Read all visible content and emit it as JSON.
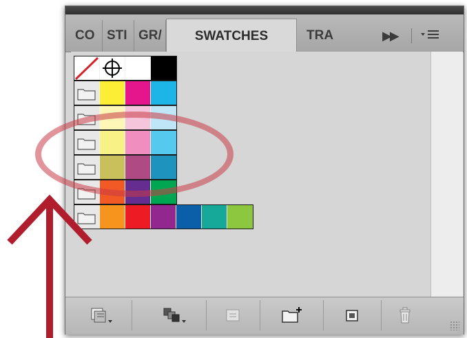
{
  "panel": {
    "tabs": [
      {
        "label": "CO",
        "active": false
      },
      {
        "label": "STI",
        "active": false
      },
      {
        "label": "GR/",
        "active": false
      },
      {
        "label": "SWATCHES",
        "active": true
      },
      {
        "label": "TRA",
        "active": false
      }
    ],
    "controls": {
      "expand_icon": "double-chevron-right",
      "menu_icon": "panel-menu"
    }
  },
  "swatches": {
    "special_row": [
      "none",
      "registration",
      "#ffffff",
      "#000000"
    ],
    "groups": [
      {
        "name": "group-1",
        "colors": [
          "#fcee35",
          "#e5158c",
          "#1db4e8"
        ]
      },
      {
        "name": "group-2",
        "colors": [
          "#fdf6b6",
          "#f5c5dc",
          "#bfe6f7"
        ]
      },
      {
        "name": "group-3",
        "colors": [
          "#f8f186",
          "#f08fbf",
          "#56c9ef"
        ]
      },
      {
        "name": "group-4",
        "colors": [
          "#c9c05c",
          "#b04a85",
          "#1e93bd"
        ]
      },
      {
        "name": "group-5",
        "colors": [
          "#f15a24",
          "#662d91",
          "#00a651"
        ]
      },
      {
        "name": "group-6",
        "colors": [
          "#f7941d",
          "#ed1c24",
          "#92278f",
          "#0b5ea8",
          "#16a99a",
          "#8dc63f"
        ]
      }
    ]
  },
  "bottom_buttons": [
    {
      "name": "swatch-libraries-menu-button",
      "icon": "libraries-icon"
    },
    {
      "name": "show-swatch-kinds-menu-button",
      "icon": "swatch-kinds-icon"
    },
    {
      "name": "swatch-options-button",
      "icon": "swatch-options-icon"
    },
    {
      "name": "new-color-group-button",
      "icon": "new-folder-icon"
    },
    {
      "name": "new-swatch-button",
      "icon": "new-swatch-icon"
    },
    {
      "name": "delete-swatch-button",
      "icon": "trash-icon"
    }
  ],
  "annotation": {
    "arrow_color": "#b01e2d",
    "ellipse_color": "#c83c46"
  }
}
